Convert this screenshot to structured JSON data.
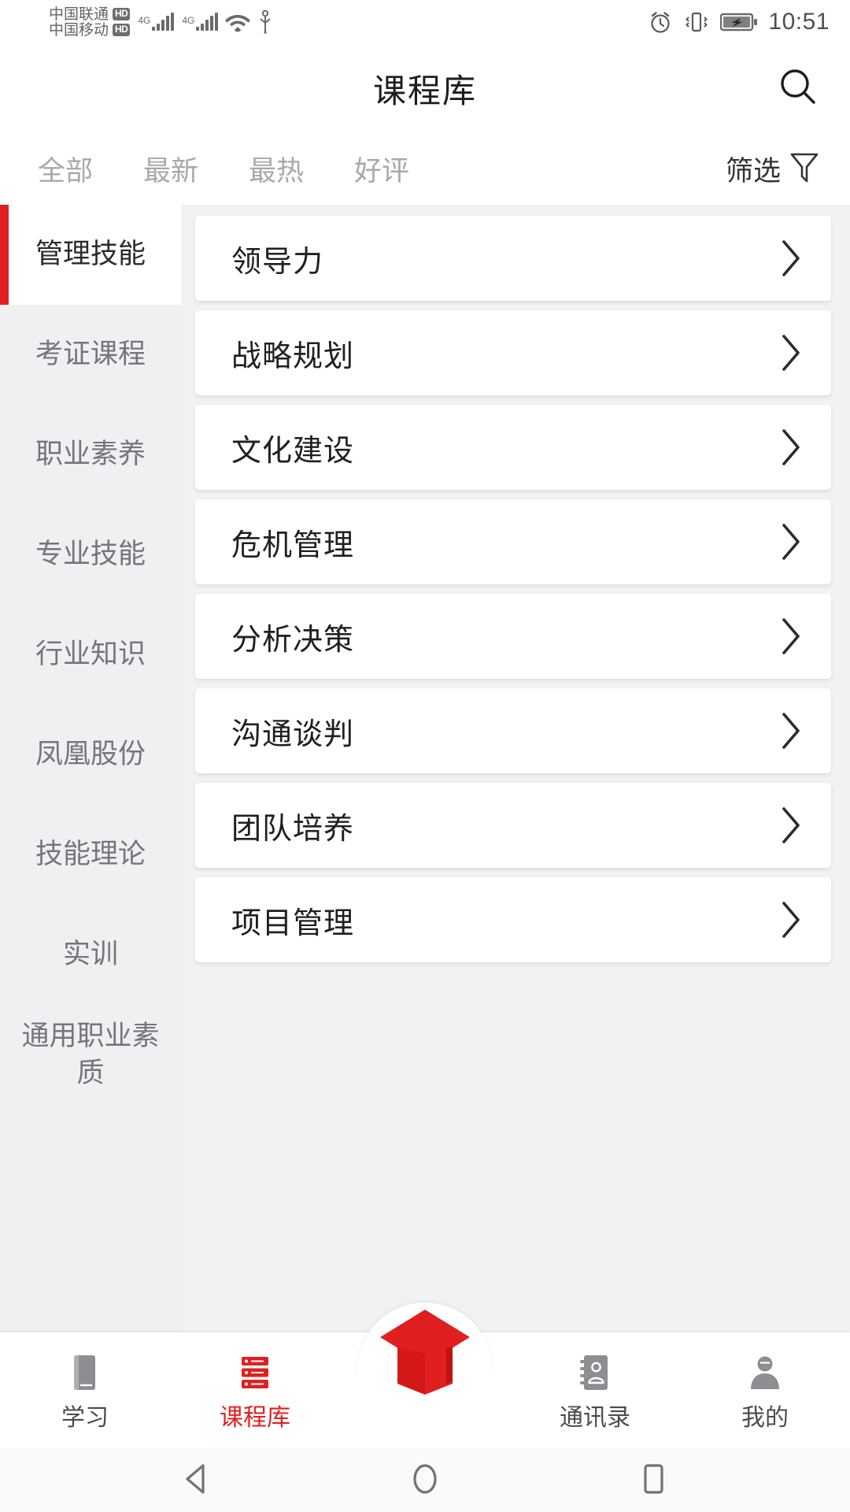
{
  "status_bar": {
    "carriers": [
      {
        "name": "中国联通",
        "badge": "HD"
      },
      {
        "name": "中国移动",
        "badge": "HD"
      }
    ],
    "signals": [
      {
        "label": "4G",
        "icon": "signal-bars-icon"
      },
      {
        "label": "4G",
        "icon": "signal-bars-icon"
      }
    ],
    "wifi_icon": "wifi-icon",
    "usb_icon": "usb-icon",
    "alarm_icon": "alarm-clock-icon",
    "vibrate_icon": "vibrate-icon",
    "battery_icon": "battery-charging-icon",
    "time": "10:51"
  },
  "header": {
    "title": "课程库",
    "search_icon": "search-icon"
  },
  "tabs": {
    "items": [
      {
        "label": "全部",
        "active": true
      },
      {
        "label": "最新",
        "active": false
      },
      {
        "label": "最热",
        "active": false
      },
      {
        "label": "好评",
        "active": false
      }
    ],
    "filter_label": "筛选",
    "filter_icon": "funnel-icon"
  },
  "sidebar": {
    "categories": [
      {
        "label": "管理技能",
        "active": true
      },
      {
        "label": "考证课程",
        "active": false
      },
      {
        "label": "职业素养",
        "active": false
      },
      {
        "label": "专业技能",
        "active": false
      },
      {
        "label": "行业知识",
        "active": false
      },
      {
        "label": "凤凰股份",
        "active": false
      },
      {
        "label": "技能理论",
        "active": false
      },
      {
        "label": "实训",
        "active": false
      },
      {
        "label": "通用职业素质",
        "active": false
      }
    ]
  },
  "course_list": {
    "chevron_icon": "chevron-right-icon",
    "items": [
      {
        "title": "领导力"
      },
      {
        "title": "战略规划"
      },
      {
        "title": "文化建设"
      },
      {
        "title": "危机管理"
      },
      {
        "title": "分析决策"
      },
      {
        "title": "沟通谈判"
      },
      {
        "title": "团队培养"
      },
      {
        "title": "项目管理"
      }
    ]
  },
  "bottom_nav": {
    "items": [
      {
        "label": "学习",
        "icon": "book-icon",
        "active": false
      },
      {
        "label": "课程库",
        "icon": "course-library-icon",
        "active": true
      },
      {
        "label": "通讯录",
        "icon": "contacts-icon",
        "active": false
      },
      {
        "label": "我的",
        "icon": "person-icon",
        "active": false
      }
    ],
    "fab_icon": "graduation-cap-icon"
  },
  "android_nav": {
    "back_icon": "triangle-back-icon",
    "home_icon": "circle-home-icon",
    "recents_icon": "square-recents-icon"
  },
  "colors": {
    "accent_red": "#e02020",
    "page_bg": "#f1f2f4",
    "sidebar_bg": "#eef0f2",
    "card_bg": "#ffffff",
    "text_primary": "#1f1f1f",
    "text_muted": "#a9a9ad"
  }
}
